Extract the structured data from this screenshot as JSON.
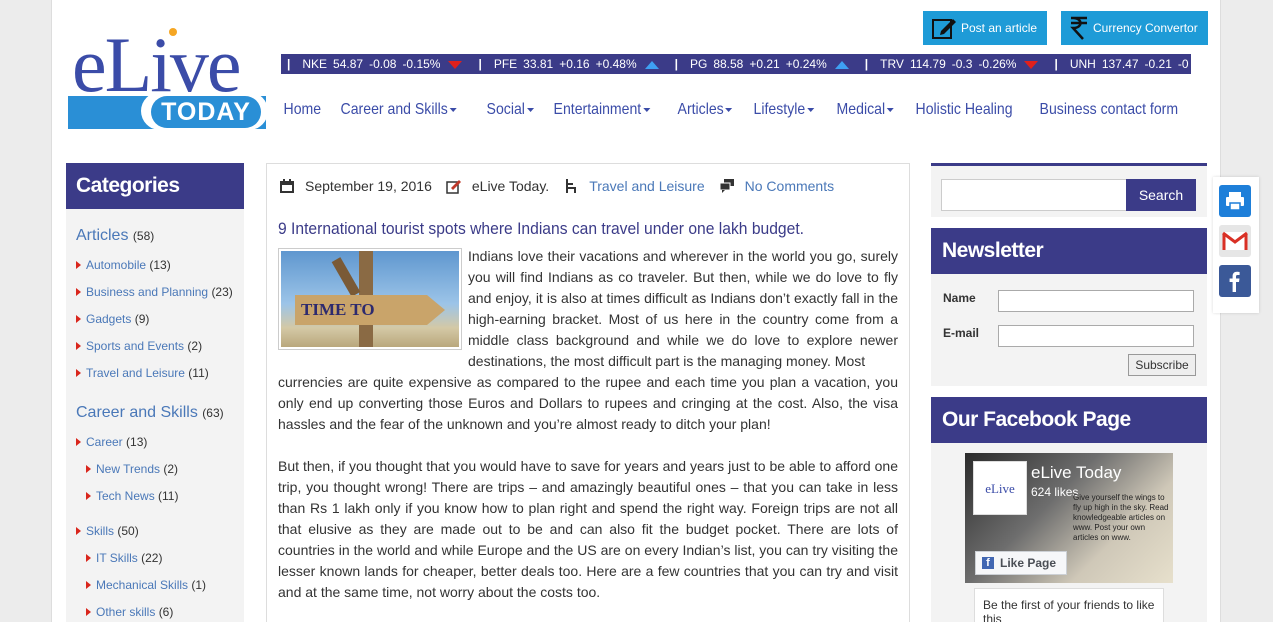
{
  "header": {
    "logo_text": "eLive",
    "logo_sub": "TODAY",
    "post_article": "Post an article",
    "currency": "Currency Convertor"
  },
  "ticker": [
    {
      "sym": "NKE",
      "price": "54.87",
      "chg": "-0.08",
      "pct": "-0.15%",
      "dir": "down"
    },
    {
      "sym": "PFE",
      "price": "33.81",
      "chg": "+0.16",
      "pct": "+0.48%",
      "dir": "up"
    },
    {
      "sym": "PG",
      "price": "88.58",
      "chg": "+0.21",
      "pct": "+0.24%",
      "dir": "up"
    },
    {
      "sym": "TRV",
      "price": "114.79",
      "chg": "-0.3",
      "pct": "-0.26%",
      "dir": "down"
    },
    {
      "sym": "UNH",
      "price": "137.47",
      "chg": "-0.21",
      "pct": "-0"
    }
  ],
  "nav": [
    {
      "label": "Home",
      "dropdown": false
    },
    {
      "label": "Career and Skills",
      "dropdown": true
    },
    {
      "label": "Social",
      "dropdown": true
    },
    {
      "label": "Entertainment",
      "dropdown": true
    },
    {
      "label": "Articles",
      "dropdown": true
    },
    {
      "label": "Lifestyle",
      "dropdown": true
    },
    {
      "label": "Medical",
      "dropdown": true
    },
    {
      "label": "Holistic Healing",
      "dropdown": false
    },
    {
      "label": "Business contact form",
      "dropdown": false
    }
  ],
  "categories": {
    "heading": "Categories",
    "articles": {
      "label": "Articles",
      "count": "(58)"
    },
    "automobile": {
      "label": "Automobile",
      "count": "(13)"
    },
    "business": {
      "label": "Business and Planning",
      "count": "(23)"
    },
    "gadgets": {
      "label": "Gadgets",
      "count": "(9)"
    },
    "sports": {
      "label": "Sports and Events",
      "count": "(2)"
    },
    "travel": {
      "label": "Travel and Leisure",
      "count": "(11)"
    },
    "career_skills": {
      "label": "Career and Skills",
      "count": "(63)"
    },
    "career": {
      "label": "Career",
      "count": "(13)"
    },
    "new_trends": {
      "label": "New Trends",
      "count": "(2)"
    },
    "tech_news": {
      "label": "Tech News",
      "count": "(11)"
    },
    "skills": {
      "label": "Skills",
      "count": "(50)"
    },
    "it_skills": {
      "label": "IT Skills",
      "count": "(22)"
    },
    "mech_skills": {
      "label": "Mechanical Skills",
      "count": "(1)"
    },
    "other_skills": {
      "label": "Other skills",
      "count": "(6)"
    }
  },
  "post": {
    "date": "September 19, 2016",
    "author": "eLive Today.",
    "category": "Travel and Leisure",
    "comments": "No Comments",
    "title": "9 International tourist spots where Indians can travel under one lakh budget.",
    "image_text": "TIME TO TRAVEL",
    "para1": "Indians love their vacations and wherever in the world you go, surely you will find Indians as co traveler. But then, while we do love to fly and enjoy, it is also at times difficult as Indians don’t exactly fall in the high-earning bracket. Most of us here in the country come from a middle class background and while we do love to explore newer destinations, the most difficult part is the managing money. Most currencies are quite expensive as compared to the rupee and each time you plan a vacation, you only end up converting those Euros and Dollars to rupees and cringing at the cost. Also, the visa hassles and the fear of the unknown and you’re almost ready to ditch your plan!",
    "para2": "But then, if you thought that you would have to save for years and years just to be able to afford one trip, you thought wrong! There are trips – and amazingly beautiful ones – that you can take in less than Rs 1 lakh only if you know how to plan right and spend the right way. Foreign trips are not all that elusive as they are made out to be and can also fit the budget pocket. There are lots of countries in the world and while Europe and the US are on every Indian’s list, you can try visiting the lesser known lands for cheaper, better deals too. Here are a few countries that you can try and visit and at the same time, not worry about the costs too."
  },
  "sidebar": {
    "search_button": "Search",
    "search_value": "",
    "newsletter_heading": "Newsletter",
    "name_label": "Name",
    "email_label": "E-mail",
    "subscribe_label": "Subscribe",
    "facebook_heading": "Our Facebook Page",
    "fb_name": "eLive Today",
    "fb_likes": "624 likes",
    "fb_like_button": "Like Page",
    "fb_logo": "eLive",
    "fb_tagline": "Give yourself the wings to fly up high in the sky. Read knowledgeable articles on www. Post your own articles on www.",
    "fb_friends": "Be the first of your friends to like this"
  }
}
